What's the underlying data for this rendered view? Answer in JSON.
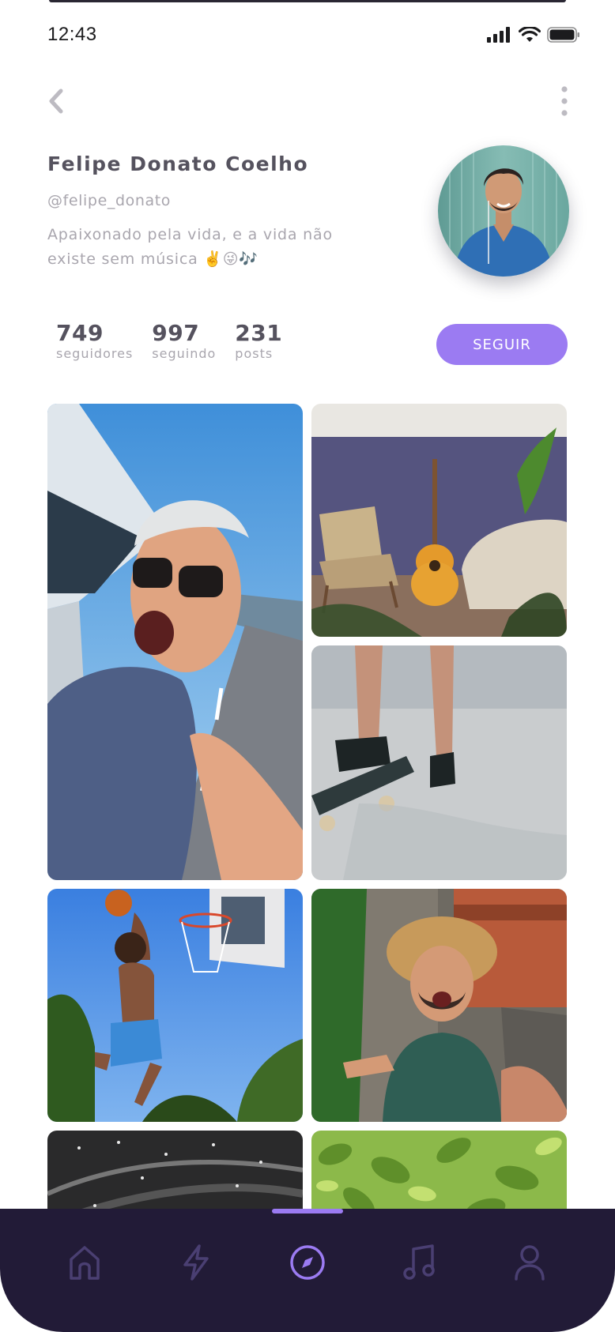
{
  "status_bar": {
    "time": "12:43",
    "icons": [
      "signal-icon",
      "wifi-icon",
      "battery-icon"
    ]
  },
  "nav": {
    "back_icon": "chevron-left-icon",
    "more_icon": "more-vertical-icon"
  },
  "profile": {
    "name": "Felipe Donato Coelho",
    "handle": "@felipe_donato",
    "bio_line1": "Apaixonado pela vida, e a vida não",
    "bio_line2": "existe sem música ✌️😜🎶"
  },
  "stats": [
    {
      "value": "749",
      "label": "seguidores"
    },
    {
      "value": "997",
      "label": "seguindo"
    },
    {
      "value": "231",
      "label": "posts"
    }
  ],
  "follow_button": {
    "label": "SEGUIR"
  },
  "gallery": {
    "photos": [
      {
        "name": "photo-selfie-car-window"
      },
      {
        "name": "photo-guitar-living-room"
      },
      {
        "name": "photo-skateboard"
      },
      {
        "name": "photo-basketball-dunk"
      },
      {
        "name": "photo-temple-selfie"
      },
      {
        "name": "photo-highway-night"
      },
      {
        "name": "photo-leaves"
      }
    ]
  },
  "tab_bar": {
    "tabs": [
      {
        "icon": "home-icon",
        "active": false
      },
      {
        "icon": "lightning-icon",
        "active": false
      },
      {
        "icon": "compass-icon",
        "active": true
      },
      {
        "icon": "music-icon",
        "active": false
      },
      {
        "icon": "user-icon",
        "active": false
      }
    ]
  },
  "colors": {
    "accent": "#9b7bf2",
    "tab_bar_bg": "#221b37",
    "tab_icon_inactive": "#4a3f72",
    "text_primary": "#55525e",
    "text_secondary": "#a9a6ae"
  }
}
